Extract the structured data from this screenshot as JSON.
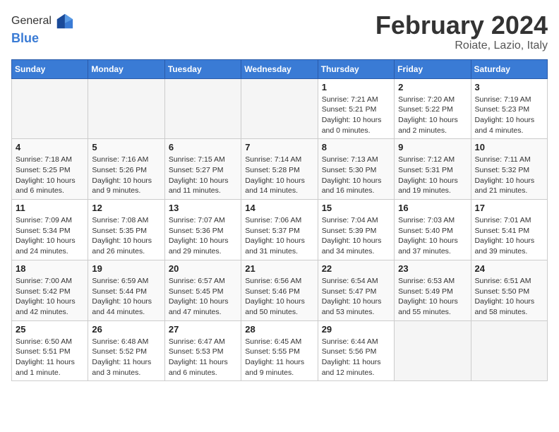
{
  "header": {
    "logo_line1": "General",
    "logo_line2": "Blue",
    "month_title": "February 2024",
    "location": "Roiate, Lazio, Italy"
  },
  "columns": [
    "Sunday",
    "Monday",
    "Tuesday",
    "Wednesday",
    "Thursday",
    "Friday",
    "Saturday"
  ],
  "weeks": [
    [
      {
        "day": "",
        "info": ""
      },
      {
        "day": "",
        "info": ""
      },
      {
        "day": "",
        "info": ""
      },
      {
        "day": "",
        "info": ""
      },
      {
        "day": "1",
        "info": "Sunrise: 7:21 AM\nSunset: 5:21 PM\nDaylight: 10 hours\nand 0 minutes."
      },
      {
        "day": "2",
        "info": "Sunrise: 7:20 AM\nSunset: 5:22 PM\nDaylight: 10 hours\nand 2 minutes."
      },
      {
        "day": "3",
        "info": "Sunrise: 7:19 AM\nSunset: 5:23 PM\nDaylight: 10 hours\nand 4 minutes."
      }
    ],
    [
      {
        "day": "4",
        "info": "Sunrise: 7:18 AM\nSunset: 5:25 PM\nDaylight: 10 hours\nand 6 minutes."
      },
      {
        "day": "5",
        "info": "Sunrise: 7:16 AM\nSunset: 5:26 PM\nDaylight: 10 hours\nand 9 minutes."
      },
      {
        "day": "6",
        "info": "Sunrise: 7:15 AM\nSunset: 5:27 PM\nDaylight: 10 hours\nand 11 minutes."
      },
      {
        "day": "7",
        "info": "Sunrise: 7:14 AM\nSunset: 5:28 PM\nDaylight: 10 hours\nand 14 minutes."
      },
      {
        "day": "8",
        "info": "Sunrise: 7:13 AM\nSunset: 5:30 PM\nDaylight: 10 hours\nand 16 minutes."
      },
      {
        "day": "9",
        "info": "Sunrise: 7:12 AM\nSunset: 5:31 PM\nDaylight: 10 hours\nand 19 minutes."
      },
      {
        "day": "10",
        "info": "Sunrise: 7:11 AM\nSunset: 5:32 PM\nDaylight: 10 hours\nand 21 minutes."
      }
    ],
    [
      {
        "day": "11",
        "info": "Sunrise: 7:09 AM\nSunset: 5:34 PM\nDaylight: 10 hours\nand 24 minutes."
      },
      {
        "day": "12",
        "info": "Sunrise: 7:08 AM\nSunset: 5:35 PM\nDaylight: 10 hours\nand 26 minutes."
      },
      {
        "day": "13",
        "info": "Sunrise: 7:07 AM\nSunset: 5:36 PM\nDaylight: 10 hours\nand 29 minutes."
      },
      {
        "day": "14",
        "info": "Sunrise: 7:06 AM\nSunset: 5:37 PM\nDaylight: 10 hours\nand 31 minutes."
      },
      {
        "day": "15",
        "info": "Sunrise: 7:04 AM\nSunset: 5:39 PM\nDaylight: 10 hours\nand 34 minutes."
      },
      {
        "day": "16",
        "info": "Sunrise: 7:03 AM\nSunset: 5:40 PM\nDaylight: 10 hours\nand 37 minutes."
      },
      {
        "day": "17",
        "info": "Sunrise: 7:01 AM\nSunset: 5:41 PM\nDaylight: 10 hours\nand 39 minutes."
      }
    ],
    [
      {
        "day": "18",
        "info": "Sunrise: 7:00 AM\nSunset: 5:42 PM\nDaylight: 10 hours\nand 42 minutes."
      },
      {
        "day": "19",
        "info": "Sunrise: 6:59 AM\nSunset: 5:44 PM\nDaylight: 10 hours\nand 44 minutes."
      },
      {
        "day": "20",
        "info": "Sunrise: 6:57 AM\nSunset: 5:45 PM\nDaylight: 10 hours\nand 47 minutes."
      },
      {
        "day": "21",
        "info": "Sunrise: 6:56 AM\nSunset: 5:46 PM\nDaylight: 10 hours\nand 50 minutes."
      },
      {
        "day": "22",
        "info": "Sunrise: 6:54 AM\nSunset: 5:47 PM\nDaylight: 10 hours\nand 53 minutes."
      },
      {
        "day": "23",
        "info": "Sunrise: 6:53 AM\nSunset: 5:49 PM\nDaylight: 10 hours\nand 55 minutes."
      },
      {
        "day": "24",
        "info": "Sunrise: 6:51 AM\nSunset: 5:50 PM\nDaylight: 10 hours\nand 58 minutes."
      }
    ],
    [
      {
        "day": "25",
        "info": "Sunrise: 6:50 AM\nSunset: 5:51 PM\nDaylight: 11 hours\nand 1 minute."
      },
      {
        "day": "26",
        "info": "Sunrise: 6:48 AM\nSunset: 5:52 PM\nDaylight: 11 hours\nand 3 minutes."
      },
      {
        "day": "27",
        "info": "Sunrise: 6:47 AM\nSunset: 5:53 PM\nDaylight: 11 hours\nand 6 minutes."
      },
      {
        "day": "28",
        "info": "Sunrise: 6:45 AM\nSunset: 5:55 PM\nDaylight: 11 hours\nand 9 minutes."
      },
      {
        "day": "29",
        "info": "Sunrise: 6:44 AM\nSunset: 5:56 PM\nDaylight: 11 hours\nand 12 minutes."
      },
      {
        "day": "",
        "info": ""
      },
      {
        "day": "",
        "info": ""
      }
    ]
  ]
}
